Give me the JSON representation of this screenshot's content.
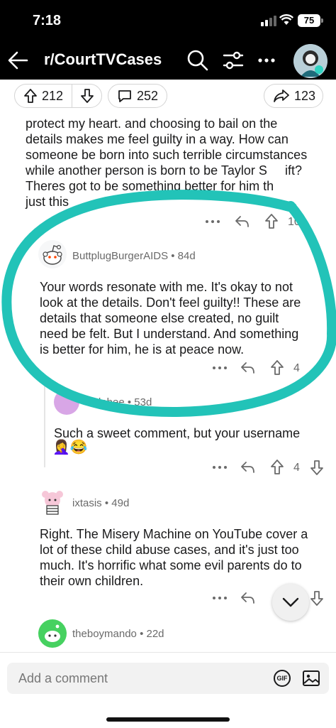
{
  "status_bar": {
    "time": "7:18",
    "battery": "75"
  },
  "header": {
    "title": "r/CourtTVCases",
    "icons": [
      "back-arrow-icon",
      "search-icon",
      "filter-icon",
      "more-icon",
      "avatar"
    ]
  },
  "post_actions": {
    "upvotes": "212",
    "comments": "252",
    "shares": "123"
  },
  "comments": [
    {
      "text_lines": [
        "protect my heart.  and choosing to bail on the",
        "details makes me feel guilty in a way.  How can",
        "someone be born into such terrible circumstances",
        "while another person is born to be Taylor S",
        "ift?",
        "Theres got to be something better for him th",
        "just this"
      ],
      "votes": "10"
    },
    {
      "author": "ButtplugBurgerAIDS",
      "age": "84d",
      "text_lines": [
        "Your words resonate with me.  It's okay to not",
        "look at the details.  Don't feel guilty!!  These are",
        "details that someone else created, no guilt",
        "need be felt.  But I understand.  And something",
        "is better for him, he is at peace now."
      ],
      "votes": "4"
    },
    {
      "author": "kylabee",
      "age": "53d",
      "text_lines": [
        "Such a sweet comment, but your username"
      ],
      "emoji": "🤦‍♀️😂",
      "votes": "4"
    },
    {
      "author": "ixtasis",
      "age": "49d",
      "text_lines": [
        "Right.  The Misery Machine on YouTube cover a",
        "lot of these child abuse cases, and it's just too",
        "much. It's horrific what some evil parents do to",
        "their own children."
      ]
    },
    {
      "author": "theboymando",
      "age": "22d"
    }
  ],
  "composer": {
    "placeholder": "Add a comment",
    "gif_label": "GIF"
  },
  "colors": {
    "annotation": "#22c3b8",
    "nav_bg": "#000000",
    "meta": "#6a6a6a"
  }
}
